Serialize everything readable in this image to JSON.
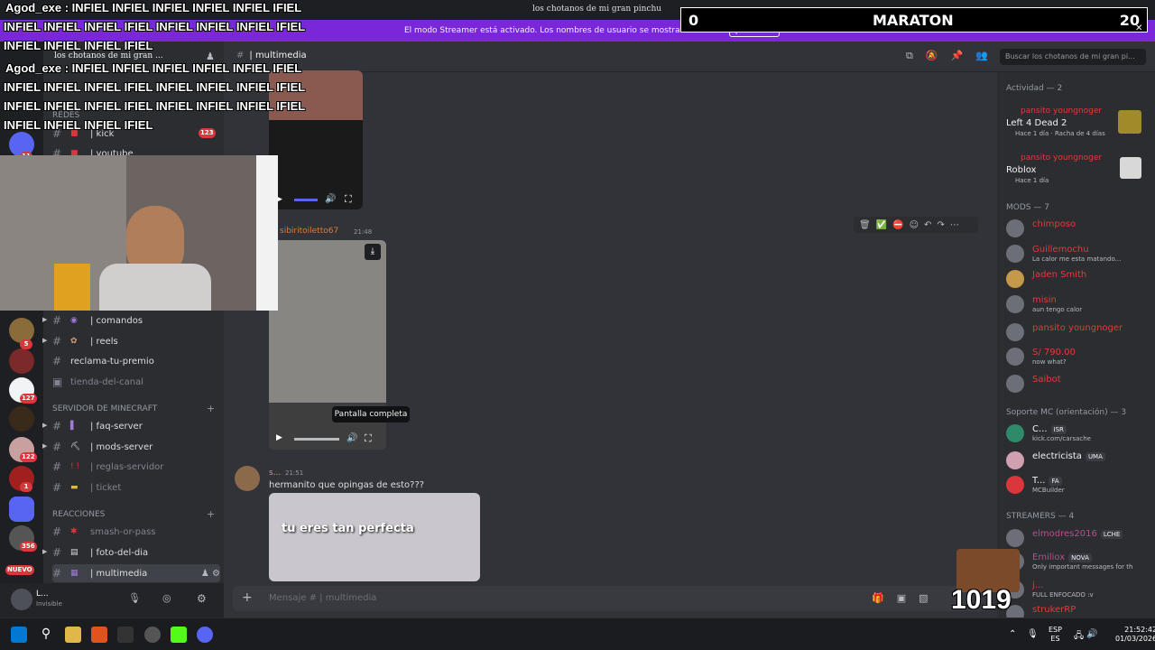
{
  "titlebar": {
    "title": "los chotanos de mi gran pinchu"
  },
  "streamer_bar": {
    "text": "El modo Streamer está activado. Los nombres de usuario se mostrarán de forma parcial.",
    "button": "Desactivar"
  },
  "server": {
    "name": "los chotanos de mi gran ..."
  },
  "header": {
    "channel": "| multimedia",
    "search_placeholder": "Buscar los chotanos de mi gran pi..."
  },
  "guild_badges": [
    "11",
    "123",
    "5",
    "127",
    "356",
    "122",
    "1"
  ],
  "guild_new_badge": "NUEVO",
  "sidebar": {
    "categories": {
      "redes": "REDES",
      "minecraft": "SERVIDOR DE MINECRAFT",
      "reacciones": "REACCIONES"
    },
    "badge": "123",
    "channels_top": [
      {
        "label": "| kick"
      },
      {
        "label": "| youtube"
      }
    ],
    "channels": [
      {
        "label": "| comandos"
      },
      {
        "label": "| reels"
      },
      {
        "label": "reclama-tu-premio"
      },
      {
        "label": "tienda-del-canal"
      }
    ],
    "minecraft": [
      {
        "label": "| faq-server"
      },
      {
        "label": "| mods-server"
      },
      {
        "label": "| reglas-servidor"
      },
      {
        "label": "| ticket"
      }
    ],
    "reacciones": [
      {
        "label": "smash-or-pass"
      },
      {
        "label": "| foto-del-dia"
      },
      {
        "label": "| multimedia"
      }
    ]
  },
  "user_panel": {
    "name": "L...",
    "status": "Invisible"
  },
  "messages": {
    "m1": {
      "author": "sibiritoiletto67",
      "time": "21:48"
    },
    "tooltip": "Pantalla completa",
    "m2": {
      "author": "s...",
      "time": "21:51",
      "text": "hermanito que opingas de esto???"
    },
    "gif_caption": "tu eres tan perfecta"
  },
  "composer": {
    "placeholder": "Mensaje #  | multimedia"
  },
  "members": {
    "activity_header": "Actividad — 2",
    "activity": [
      {
        "name": "pansito youngnoger",
        "game": "Left 4 Dead 2",
        "detail": "Hace 1 día · Racha de 4 días"
      },
      {
        "name": "pansito youngnoger",
        "game": "Roblox",
        "detail": "Hace 1 día"
      }
    ],
    "mods_header": "MODS — 7",
    "mods": [
      {
        "name": "chimposo",
        "status": ""
      },
      {
        "name": "Guillemochu",
        "status": "La calor me esta matando..."
      },
      {
        "name": "Jaden Smith",
        "status": ""
      },
      {
        "name": "misin",
        "status": "aun tengo calor"
      },
      {
        "name": "pansito youngnoger",
        "status": ""
      },
      {
        "name": "S/ 790.00",
        "status": "now what?"
      },
      {
        "name": "Saibot",
        "status": ""
      }
    ],
    "soporte_header": "Soporte MC (orientación) — 3",
    "soporte": [
      {
        "name": "C...",
        "tag": "ISR",
        "status": "kick.com/carsache"
      },
      {
        "name": "electricista",
        "tag": "UMA",
        "status": ""
      },
      {
        "name": "T...",
        "tag": "FA",
        "status": "MCBuilder"
      }
    ],
    "streamers_header": "STREAMERS — 4",
    "streamers": [
      {
        "name": "elmodres2016",
        "tag": "LCHE",
        "status": ""
      },
      {
        "name": "Emiliox",
        "tag": "NOVA",
        "status": "Only important messages for th"
      },
      {
        "name": "j...",
        "tag": "",
        "status": "FULL ENFOCADO :v"
      },
      {
        "name": "strukerRP",
        "tag": "",
        "status": ""
      }
    ]
  },
  "overlay": {
    "chat_lines": [
      "Agod_exe : INFIEL INFIEL INFIEL INFIEL INFIEL IFIEL",
      "INFIEL INFIEL INFIEL IFIEL INFIEL INFIEL INFIEL IFIEL",
      "INFIEL INFIEL INFIEL IFIEL",
      "Agod_exe : INFIEL INFIEL INFIEL INFIEL INFIEL IFIEL",
      "INFIEL INFIEL INFIEL IFIEL INFIEL INFIEL INFIEL IFIEL",
      "INFIEL INFIEL INFIEL IFIEL INFIEL INFIEL INFIEL IFIEL",
      "INFIEL INFIEL INFIEL IFIEL"
    ],
    "scoreboard": {
      "left": "0",
      "title": "MARATON",
      "right": "20"
    },
    "counter": "1019"
  },
  "taskbar": {
    "lang": "ESP",
    "lang2": "ES",
    "time": "21:52:42",
    "date": "01/03/2026"
  }
}
